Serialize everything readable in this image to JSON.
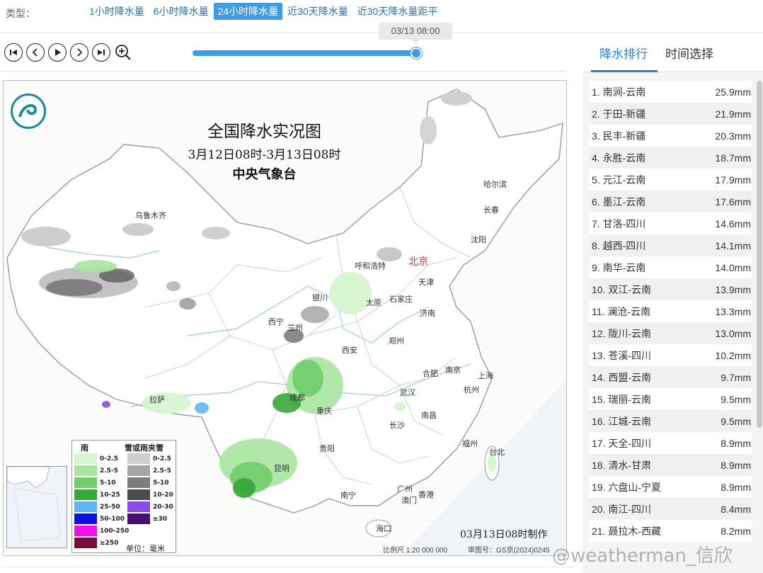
{
  "type_bar": {
    "label": "类型：",
    "tabs": [
      {
        "label": "1小时降水量",
        "active": false
      },
      {
        "label": "6小时降水量",
        "active": false
      },
      {
        "label": "24小时降水量",
        "active": true
      },
      {
        "label": "近30天降水量",
        "active": false
      },
      {
        "label": "近30天降水量距平",
        "active": false
      }
    ]
  },
  "controls": {
    "buttons": [
      "first-frame-icon",
      "prev-frame-icon",
      "play-icon",
      "next-frame-icon",
      "last-frame-icon",
      "zoom-in-icon"
    ],
    "timeline_value": "03/13 08:00",
    "timeline_progress": 1.0
  },
  "map": {
    "title": "全国降水实况图",
    "period": "3月12日08时-3月13日08时",
    "agency": "中央气象台",
    "made_time": "03月13日08时制作",
    "scale": "比例尺 1:20 000 000",
    "approval": "审图号：GS京(2024)0245",
    "cities": {
      "wulumuqi": "乌鲁木齐",
      "haerbin": "哈尔滨",
      "changchun": "长春",
      "shenyang": "沈阳",
      "huhehaote": "呼和浩特",
      "beijing": "北京",
      "tianjin": "天津",
      "yinchuan": "银川",
      "taiyuan": "太原",
      "shijiazhuang": "石家庄",
      "jinan": "济南",
      "xining": "西宁",
      "lanzhou": "兰州",
      "zhengzhou": "郑州",
      "xian": "西安",
      "hefei": "合肥",
      "nanjing": "南京",
      "shanghai": "上海",
      "lasa": "拉萨",
      "chengdu": "成都",
      "wuhan": "武汉",
      "hangzhou": "杭州",
      "chongqing": "重庆",
      "changsha": "长沙",
      "nanchang": "南昌",
      "guiyang": "贵阳",
      "fuzhou": "福州",
      "taibei": "台北",
      "kunming": "昆明",
      "nanning": "南宁",
      "guangzhou": "广州",
      "xianggang": "香港",
      "aomen": "澳门",
      "haikou": "海口"
    },
    "legend": {
      "rain_title": "雨",
      "snow_title": "雪或雨夹雪",
      "unit": "单位：毫米",
      "rain": [
        {
          "label": "0-2.5",
          "color": "#d6f5d0"
        },
        {
          "label": "2.5-5",
          "color": "#a8e6a0"
        },
        {
          "label": "5-10",
          "color": "#70cd6a"
        },
        {
          "label": "10-25",
          "color": "#37a83a"
        },
        {
          "label": "25-50",
          "color": "#5fb6f0"
        },
        {
          "label": "50-100",
          "color": "#0a12e8"
        },
        {
          "label": "100-250",
          "color": "#f010e8"
        },
        {
          "label": "≥250",
          "color": "#7a0f3c"
        }
      ],
      "snow": [
        {
          "label": "0-2.5",
          "color": "#cfcfcf"
        },
        {
          "label": "2.5-5",
          "color": "#a6a6a6"
        },
        {
          "label": "5-10",
          "color": "#7d7d7d"
        },
        {
          "label": "10-20",
          "color": "#4c4c4c"
        },
        {
          "label": "20-30",
          "color": "#8a4fe0"
        },
        {
          "label": "≥30",
          "color": "#4a0f70"
        }
      ]
    }
  },
  "right_panel": {
    "tabs": [
      {
        "label": "降水排行",
        "active": true
      },
      {
        "label": "时间选择",
        "active": false
      }
    ],
    "ranking": [
      {
        "name": "1. 南涧-云南",
        "value": "25.9mm"
      },
      {
        "name": "2. 于田-新疆",
        "value": "21.9mm"
      },
      {
        "name": "3. 民丰-新疆",
        "value": "20.3mm"
      },
      {
        "name": "4. 永胜-云南",
        "value": "18.7mm"
      },
      {
        "name": "5. 元江-云南",
        "value": "17.9mm"
      },
      {
        "name": "6. 墨江-云南",
        "value": "17.6mm"
      },
      {
        "name": "7. 甘洛-四川",
        "value": "14.6mm"
      },
      {
        "name": "8. 越西-四川",
        "value": "14.1mm"
      },
      {
        "name": "9. 南华-云南",
        "value": "14.0mm"
      },
      {
        "name": "10. 双江-云南",
        "value": "13.9mm"
      },
      {
        "name": "11. 澜沧-云南",
        "value": "13.3mm"
      },
      {
        "name": "12. 陇川-云南",
        "value": "13.0mm"
      },
      {
        "name": "13. 苍溪-四川",
        "value": "10.2mm"
      },
      {
        "name": "14. 西盟-云南",
        "value": "9.7mm"
      },
      {
        "name": "15. 瑞丽-云南",
        "value": "9.5mm"
      },
      {
        "name": "16. 江城-云南",
        "value": "9.5mm"
      },
      {
        "name": "17. 天全-四川",
        "value": "8.9mm"
      },
      {
        "name": "18. 清水-甘肃",
        "value": "8.9mm"
      },
      {
        "name": "19. 六盘山-宁夏",
        "value": "8.9mm"
      },
      {
        "name": "20. 南江-四川",
        "value": "8.4mm"
      },
      {
        "name": "21. 聂拉木-西藏",
        "value": "8.2mm"
      }
    ]
  },
  "watermark": "@weatherman_信欣"
}
